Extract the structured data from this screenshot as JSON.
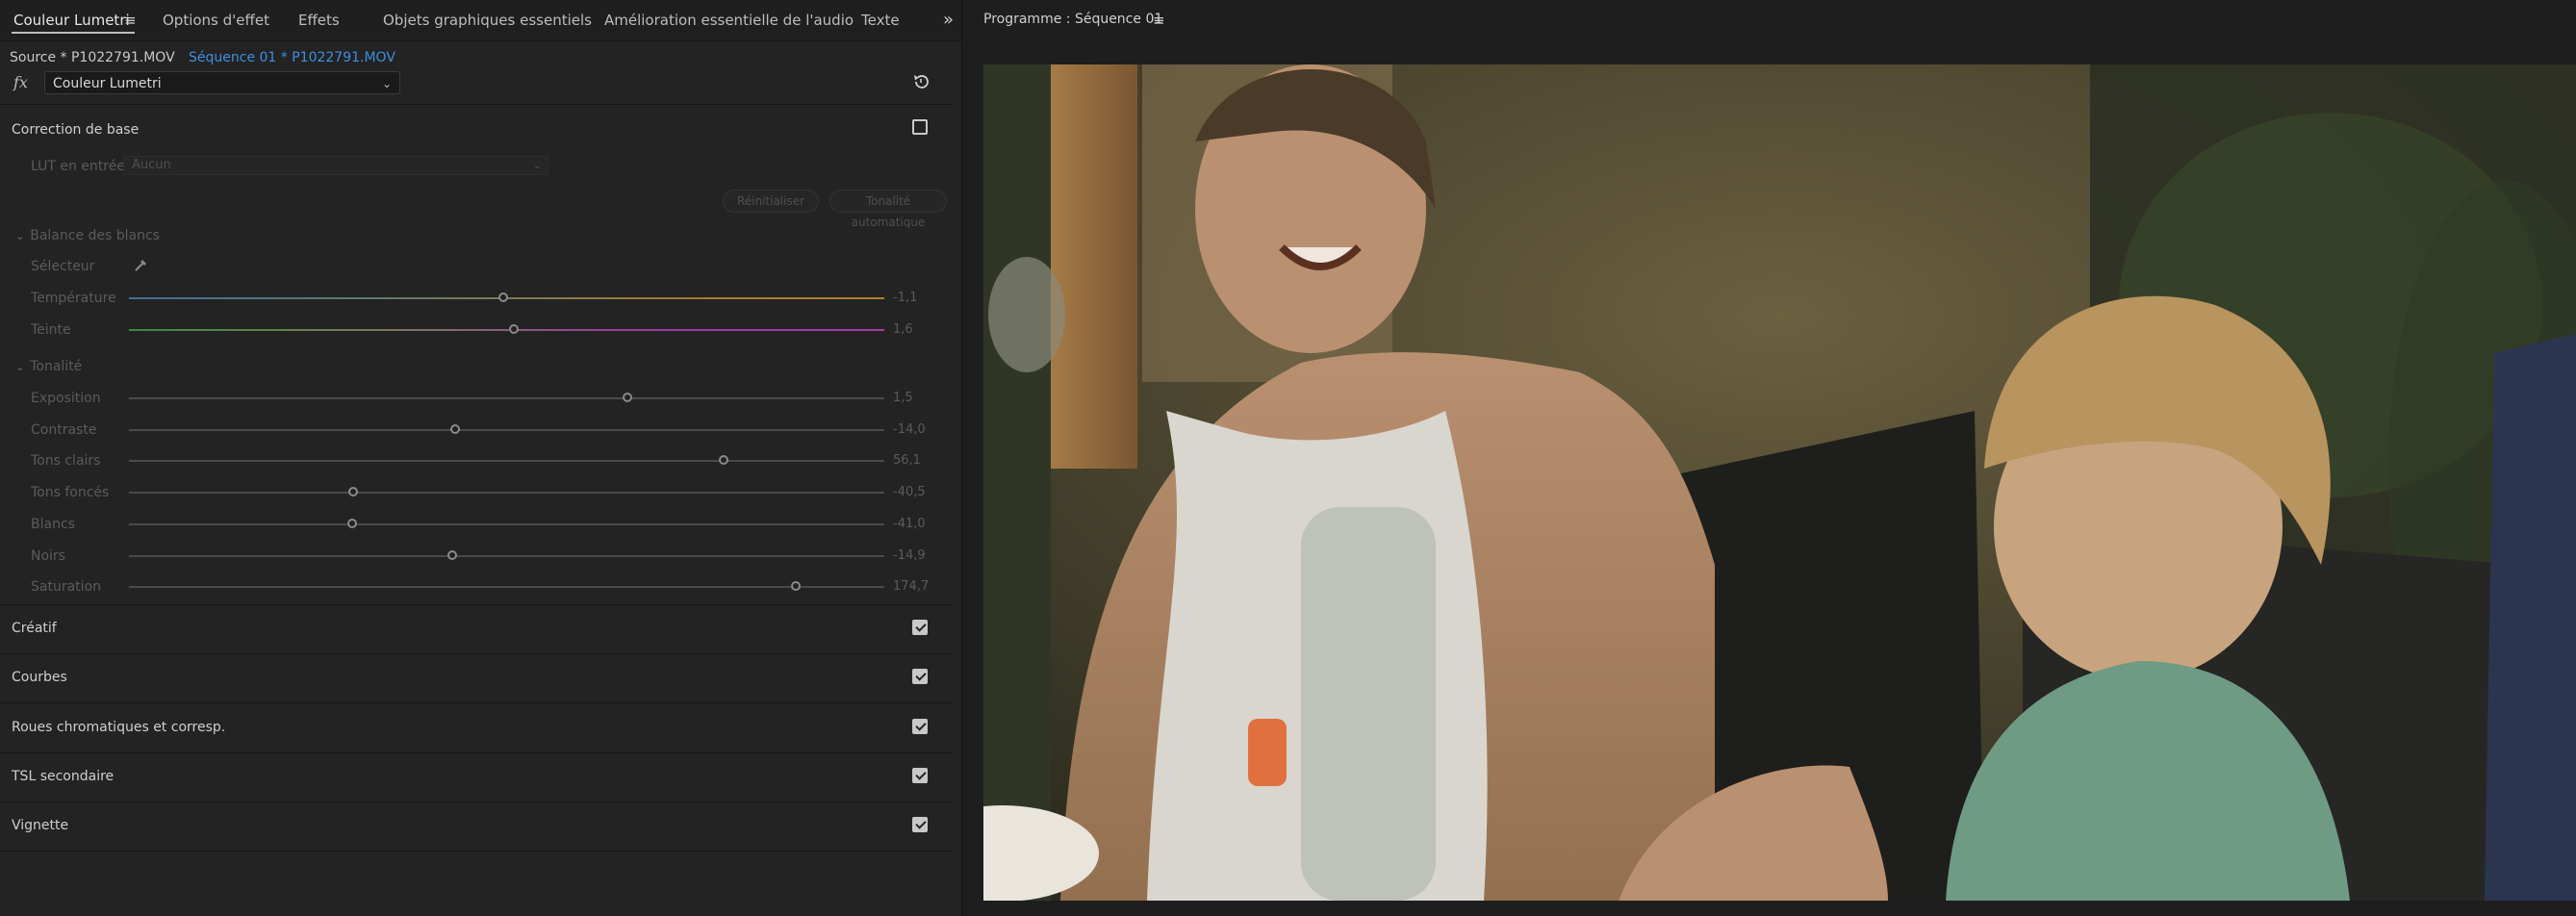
{
  "tabs": [
    {
      "label": "Couleur Lumetri",
      "active": true
    },
    {
      "label": "Options d'effet",
      "active": false
    },
    {
      "label": "Effets",
      "active": false
    },
    {
      "label": "Objets graphiques essentiels",
      "active": false
    },
    {
      "label": "Amélioration essentielle de l'audio",
      "active": false
    },
    {
      "label": "Texte",
      "active": false
    }
  ],
  "tab_overflow_label": "»",
  "source": {
    "source_label": "Source * P1022791.MOV",
    "sequence_label": "Séquence 01 * P1022791.MOV"
  },
  "fx": {
    "label": "fx",
    "effect_name": "Couleur Lumetri"
  },
  "basic": {
    "title": "Correction de base",
    "lut_label": "LUT en entrée",
    "lut_value": "Aucun",
    "reset_button": "Réinitialiser",
    "auto_button": "Tonalité automatique",
    "white_balance": {
      "title": "Balance des blancs",
      "selector_label": "Sélecteur",
      "sliders": [
        {
          "label": "Température",
          "value": "-1,1",
          "pos": 0.495
        },
        {
          "label": "Teinte",
          "value": "1,6",
          "pos": 0.51
        }
      ]
    },
    "tone": {
      "title": "Tonalité",
      "sliders": [
        {
          "label": "Exposition",
          "value": "1,5",
          "pos": 0.66
        },
        {
          "label": "Contraste",
          "value": "-14,0",
          "pos": 0.432
        },
        {
          "label": "Tons clairs",
          "value": "56,1",
          "pos": 0.787
        },
        {
          "label": "Tons foncés",
          "value": "-40,5",
          "pos": 0.297
        },
        {
          "label": "Blancs",
          "value": "-41,0",
          "pos": 0.295
        },
        {
          "label": "Noirs",
          "value": "-14,9",
          "pos": 0.428
        },
        {
          "label": "Saturation",
          "value": "174,7",
          "pos": 0.883
        }
      ]
    }
  },
  "sections": [
    {
      "label": "Créatif",
      "checked": true
    },
    {
      "label": "Courbes",
      "checked": true
    },
    {
      "label": "Roues chromatiques et corresp.",
      "checked": true
    },
    {
      "label": "TSL secondaire",
      "checked": true
    },
    {
      "label": "Vignette",
      "checked": true
    }
  ],
  "program": {
    "title": "Programme : Séquence 01"
  },
  "colors": {
    "accent_link": "#3d8fe0",
    "panel_bg": "#232323"
  }
}
